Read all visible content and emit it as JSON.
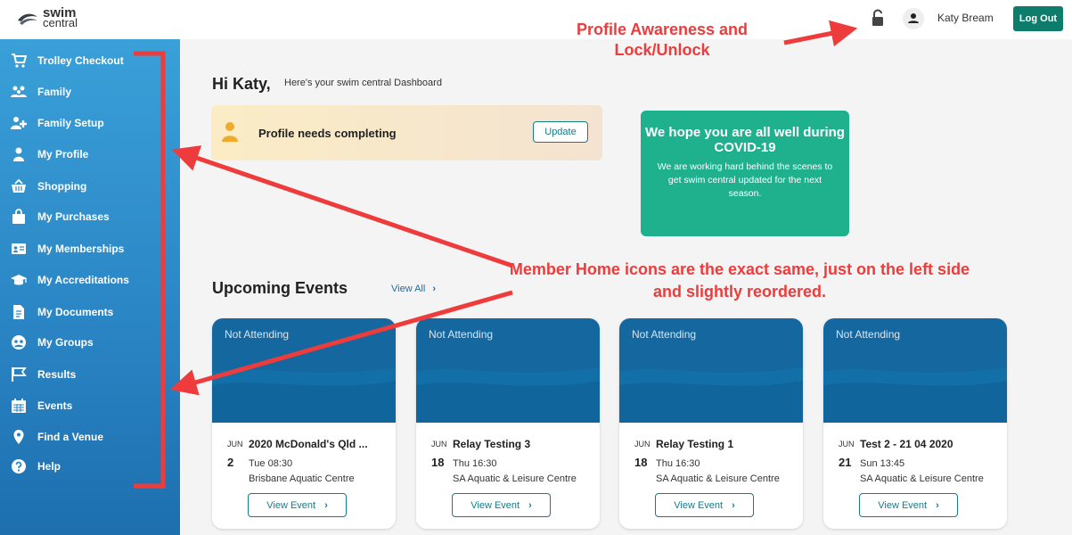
{
  "header": {
    "logo_line1": "swim",
    "logo_line2": "central",
    "user_name": "Katy Bream",
    "logout_label": "Log Out"
  },
  "sidebar": {
    "items": [
      {
        "label": "Trolley Checkout",
        "icon": "cart-icon"
      },
      {
        "label": "Family",
        "icon": "family-icon"
      },
      {
        "label": "Family Setup",
        "icon": "family-setup-icon"
      },
      {
        "label": "My Profile",
        "icon": "person-icon"
      },
      {
        "label": "Shopping",
        "icon": "basket-icon"
      },
      {
        "label": "My Purchases",
        "icon": "bag-icon"
      },
      {
        "label": "My Memberships",
        "icon": "id-card-icon"
      },
      {
        "label": "My Accreditations",
        "icon": "graduation-cap-icon"
      },
      {
        "label": "My Documents",
        "icon": "document-icon"
      },
      {
        "label": "My Groups",
        "icon": "group-icon"
      },
      {
        "label": "Results",
        "icon": "flag-icon"
      },
      {
        "label": "Events",
        "icon": "calendar-icon"
      },
      {
        "label": "Find a Venue",
        "icon": "map-pin-icon"
      },
      {
        "label": "Help",
        "icon": "help-icon"
      }
    ]
  },
  "main": {
    "greeting": "Hi Katy,",
    "greeting_sub": "Here's your swim central Dashboard",
    "profile_card": {
      "text": "Profile needs completing",
      "button": "Update"
    },
    "covid": {
      "heading": "We hope you are all well during COVID-19",
      "body": "We are working hard behind the scenes to get swim central updated for the next season."
    },
    "events_title": "Upcoming Events",
    "view_all": "View All",
    "events": [
      {
        "status": "Not Attending",
        "month": "JUN",
        "day": "2",
        "title": "2020 McDonald's Qld ...",
        "time": "Tue 08:30",
        "venue": "Brisbane Aquatic Centre",
        "button": "View Event"
      },
      {
        "status": "Not Attending",
        "month": "JUN",
        "day": "18",
        "title": "Relay Testing 3",
        "time": "Thu 16:30",
        "venue": "SA Aquatic & Leisure Centre",
        "button": "View Event"
      },
      {
        "status": "Not Attending",
        "month": "JUN",
        "day": "18",
        "title": "Relay Testing 1",
        "time": "Thu 16:30",
        "venue": "SA Aquatic & Leisure Centre",
        "button": "View Event"
      },
      {
        "status": "Not Attending",
        "month": "JUN",
        "day": "21",
        "title": "Test 2 - 21 04 2020",
        "time": "Sun 13:45",
        "venue": "SA Aquatic & Leisure Centre",
        "button": "View Event"
      }
    ]
  },
  "annotations": {
    "top": "Profile Awareness and Lock/Unlock",
    "middle": "Member Home icons are the exact same, just on the left side and slightly reordered."
  },
  "colors": {
    "sidebar_top": "#3aa0d8",
    "sidebar_bottom": "#1d6fae",
    "logout_bg": "#0e7c6b",
    "covid_bg": "#1fb08d",
    "event_card_bg": "#15689f",
    "annotation": "#ee3b3b"
  }
}
